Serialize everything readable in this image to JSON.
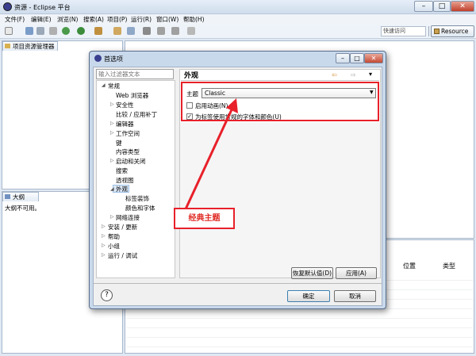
{
  "window": {
    "title": "资源 - Eclipse 平台",
    "min": "–",
    "max": "□",
    "close": "✕"
  },
  "menubar": {
    "items": [
      "文件(F)",
      "编辑(E)",
      "浏览(N)",
      "搜索(A)",
      "项目(P)",
      "运行(R)",
      "窗口(W)",
      "帮助(H)"
    ]
  },
  "toolbar": {
    "quick_access": "快速访问",
    "perspective": "Resource"
  },
  "views": {
    "project_explorer": "项目资源管理器",
    "outline": "大纲",
    "outline_message": "大纲不可用。",
    "task_columns": [
      "位置",
      "类型"
    ]
  },
  "dialog": {
    "title": "首选项",
    "filter_placeholder": "输入过滤器文本",
    "tree": {
      "general": "常规",
      "web_browser": "Web 浏览器",
      "security": "安全性",
      "compare_patch": "比较 / 应用补丁",
      "editors": "编辑器",
      "workspace": "工作空间",
      "keys": "键",
      "content_types": "内容类型",
      "startup_shutdown": "启动和关闭",
      "search": "搜索",
      "perspectives": "透视图",
      "appearance": "外观",
      "label_decorations": "标签装饰",
      "colors_fonts": "颜色和字体",
      "network": "网络连接",
      "install_update": "安装 / 更新",
      "help": "帮助",
      "team": "小组",
      "run_debug": "运行 / 调试"
    },
    "page": {
      "title": "外观",
      "theme_label": "主题",
      "theme_value": "Classic",
      "enable_animations": "启用动画(N)",
      "enable_animations_checked": false,
      "use_mru": "为标签使用常规的字体和颜色(U)",
      "use_mru_checked": true,
      "check_mark": "✓"
    },
    "buttons": {
      "restore_defaults": "恢复默认值(D)",
      "apply": "应用(A)",
      "ok": "确定",
      "cancel": "取消",
      "help": "?"
    }
  },
  "annotation": {
    "callout": "经典主题",
    "color": "#e8202a"
  }
}
